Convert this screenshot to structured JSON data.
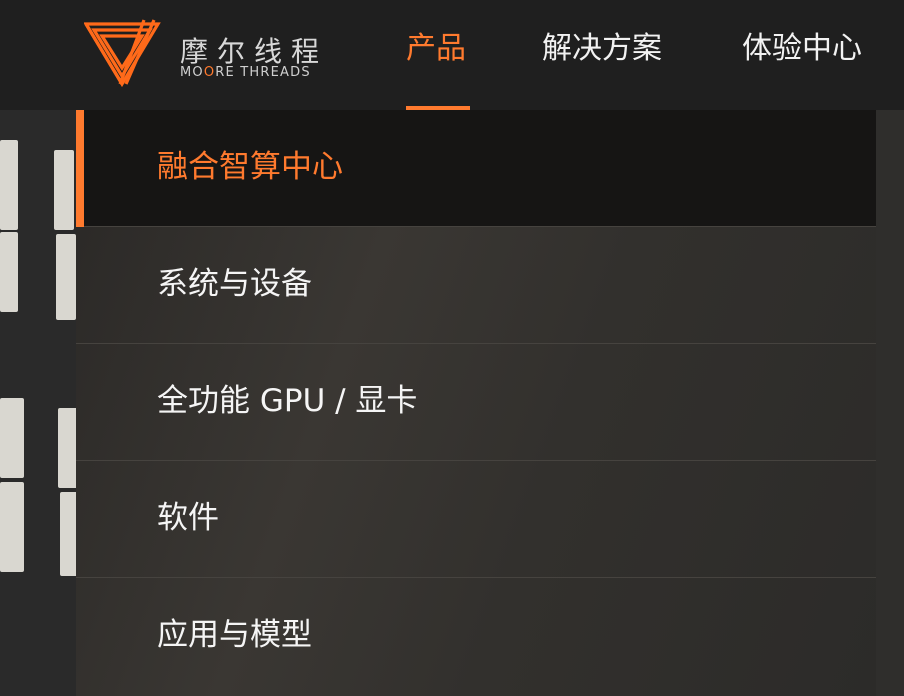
{
  "brand": {
    "name_cn": "摩尔线程",
    "name_en_prefix": "MO",
    "name_en_accent": "O",
    "name_en_suffix": "RE THREADS",
    "logo_icon": "moore-threads-triangle-logo",
    "accent_color": "#ff7a2e"
  },
  "nav": {
    "items": [
      {
        "label": "产品",
        "active": true
      },
      {
        "label": "解决方案",
        "active": false
      },
      {
        "label": "体验中心",
        "active": false
      }
    ]
  },
  "dropdown": {
    "items": [
      {
        "label": "融合智算中心",
        "active": true
      },
      {
        "label": "系统与设备",
        "active": false
      },
      {
        "label": "全功能 GPU / 显卡",
        "active": false
      },
      {
        "label": "软件",
        "active": false
      },
      {
        "label": "应用与模型",
        "active": false
      }
    ]
  }
}
